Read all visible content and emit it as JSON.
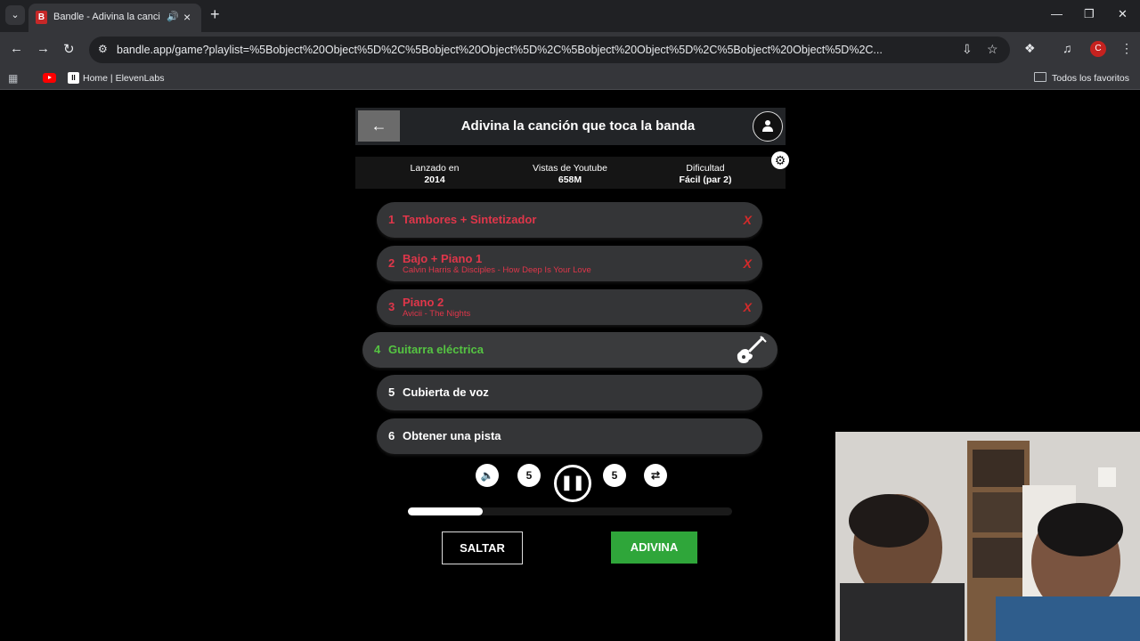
{
  "browser": {
    "tab_title": "Bandle - Adivina la canción",
    "tab_audio_icon": "speaker-icon",
    "url": "bandle.app/game?playlist=%5Bobject%20Object%5D%2C%5Bobject%20Object%5D%2C%5Bobject%20Object%5D%2C%5Bobject%20Object%5D%2C...",
    "profile_initial": "C",
    "bookmarks": [
      {
        "label": "Home | ElevenLabs"
      }
    ],
    "all_bookmarks_label": "Todos los favoritos"
  },
  "game": {
    "title": "Adivina la canción que toca la banda",
    "info": [
      {
        "label": "Lanzado en",
        "value": "2014"
      },
      {
        "label": "Vistas de Youtube",
        "value": "658M"
      },
      {
        "label": "Dificultad",
        "value": "Fácil (par 2)"
      }
    ],
    "tracks": [
      {
        "num": "1",
        "label": "Tambores + Sintetizador",
        "sub": "",
        "mark": "X",
        "state": "wrong"
      },
      {
        "num": "2",
        "label": "Bajo + Piano 1",
        "sub": "Calvin Harris & Disciples - How Deep Is Your Love",
        "mark": "X",
        "state": "wrong"
      },
      {
        "num": "3",
        "label": "Piano 2",
        "sub": "Avicii - The Nights",
        "mark": "X",
        "state": "wrong"
      },
      {
        "num": "4",
        "label": "Guitarra eléctrica",
        "sub": "",
        "mark": "",
        "state": "active"
      },
      {
        "num": "5",
        "label": "Cubierta de voz",
        "sub": "",
        "mark": "",
        "state": "locked"
      },
      {
        "num": "6",
        "label": "Obtener una pista",
        "sub": "",
        "mark": "",
        "state": "locked"
      }
    ],
    "controls": {
      "rewind_label": "5",
      "forward_label": "5"
    },
    "progress": 0.23,
    "skip_label": "SALTAR",
    "guess_label": "ADIVINA",
    "colors": {
      "wrong": "#e0364a",
      "active": "#55c442",
      "guess": "#2fa63a"
    }
  }
}
